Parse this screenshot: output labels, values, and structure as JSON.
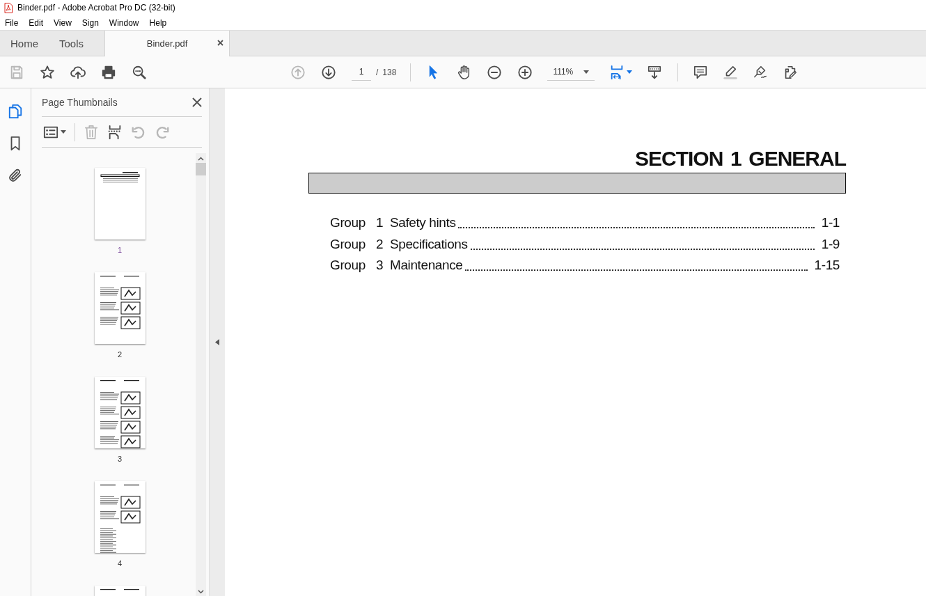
{
  "window": {
    "title": "Binder.pdf - Adobe Acrobat Pro DC (32-bit)"
  },
  "menu": [
    "File",
    "Edit",
    "View",
    "Sign",
    "Window",
    "Help"
  ],
  "tabs": [
    {
      "label": "Home",
      "kind": "nav",
      "selected": false
    },
    {
      "label": "Tools",
      "kind": "nav",
      "selected": false
    },
    {
      "label": "Binder.pdf",
      "kind": "document",
      "selected": true
    }
  ],
  "toolbar": {
    "file_tools": [
      {
        "kind": "save",
        "disabled": true
      },
      {
        "kind": "star",
        "disabled": false
      },
      {
        "kind": "upload",
        "disabled": false
      },
      {
        "kind": "print",
        "disabled": false
      },
      {
        "kind": "find",
        "disabled": false
      }
    ],
    "navigation": [
      {
        "kind": "page_up",
        "disabled": true
      },
      {
        "kind": "page_down",
        "disabled": false
      }
    ],
    "page": {
      "current": "1",
      "separator": "/",
      "total": "138"
    },
    "tools": [
      {
        "kind": "select",
        "selected": true
      },
      {
        "kind": "hand",
        "selected": false
      },
      {
        "kind": "zoom_out",
        "selected": false
      },
      {
        "kind": "zoom_in",
        "selected": false
      }
    ],
    "zoom": {
      "value": "111%"
    },
    "view_tools": [
      {
        "kind": "fit"
      },
      {
        "kind": "scroll"
      }
    ],
    "annotate_tools": [
      {
        "kind": "comment"
      },
      {
        "kind": "highlight"
      },
      {
        "kind": "sign"
      },
      {
        "kind": "edit"
      }
    ]
  },
  "rail": [
    {
      "kind": "pages",
      "selected": true
    },
    {
      "kind": "bookmarks",
      "selected": false
    },
    {
      "kind": "attachments",
      "selected": false
    }
  ],
  "panel": {
    "title": "Page Thumbnails",
    "tools": [
      {
        "kind": "options",
        "disabled": false
      },
      {
        "kind": "delete",
        "disabled": true
      },
      {
        "kind": "insert",
        "disabled": false
      },
      {
        "kind": "rotate_left",
        "disabled": true
      },
      {
        "kind": "rotate_right",
        "disabled": true
      }
    ],
    "thumbnails": [
      {
        "kind": "page",
        "label": "1",
        "selected": true
      },
      {
        "kind": "page",
        "label": "2",
        "selected": false
      },
      {
        "kind": "page",
        "label": "3",
        "selected": false
      },
      {
        "kind": "page",
        "label": "4",
        "selected": false
      },
      {
        "kind": "page"
      }
    ]
  },
  "document": {
    "heading": "SECTION  1  GENERAL",
    "contents": [
      {
        "group": "Group",
        "number": "1",
        "title": "Safety hints",
        "page": "1-1"
      },
      {
        "group": "Group",
        "number": "2",
        "title": "Specifications",
        "page": "1-9"
      },
      {
        "group": "Group",
        "number": "3",
        "title": "Maintenance",
        "page": "1-15"
      }
    ]
  }
}
